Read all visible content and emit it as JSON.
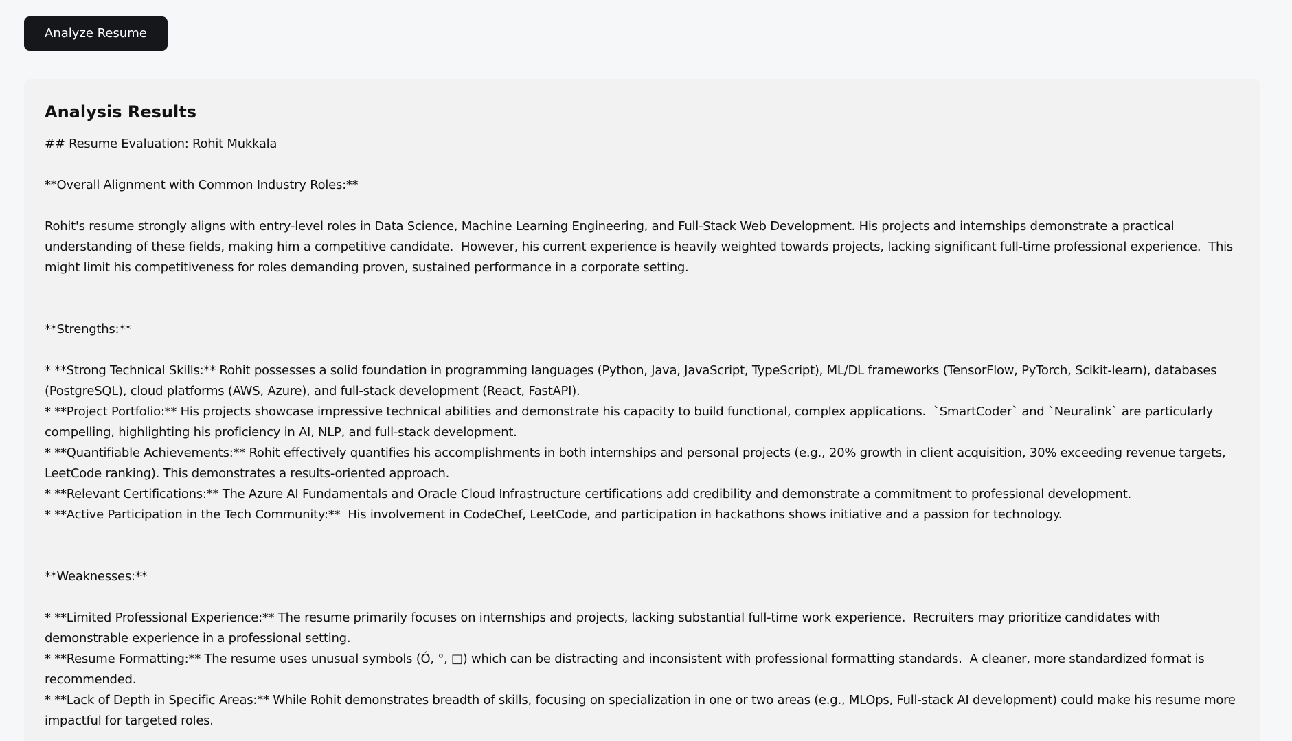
{
  "toolbar": {
    "analyze_label": "Analyze Resume"
  },
  "results": {
    "title": "Analysis Results",
    "body": "## Resume Evaluation: Rohit Mukkala\n\n**Overall Alignment with Common Industry Roles:**\n\nRohit's resume strongly aligns with entry-level roles in Data Science, Machine Learning Engineering, and Full-Stack Web Development. His projects and internships demonstrate a practical understanding of these fields, making him a competitive candidate.  However, his current experience is heavily weighted towards projects, lacking significant full-time professional experience.  This might limit his competitiveness for roles demanding proven, sustained performance in a corporate setting.\n\n\n**Strengths:**\n\n* **Strong Technical Skills:** Rohit possesses a solid foundation in programming languages (Python, Java, JavaScript, TypeScript), ML/DL frameworks (TensorFlow, PyTorch, Scikit-learn), databases (PostgreSQL), cloud platforms (AWS, Azure), and full-stack development (React, FastAPI).\n* **Project Portfolio:** His projects showcase impressive technical abilities and demonstrate his capacity to build functional, complex applications.  `SmartCoder` and `Neuralink` are particularly compelling, highlighting his proficiency in AI, NLP, and full-stack development.\n* **Quantifiable Achievements:** Rohit effectively quantifies his accomplishments in both internships and personal projects (e.g., 20% growth in client acquisition, 30% exceeding revenue targets, LeetCode ranking). This demonstrates a results-oriented approach.\n* **Relevant Certifications:** The Azure AI Fundamentals and Oracle Cloud Infrastructure certifications add credibility and demonstrate a commitment to professional development.\n* **Active Participation in the Tech Community:**  His involvement in CodeChef, LeetCode, and participation in hackathons shows initiative and a passion for technology.\n\n\n**Weaknesses:**\n\n* **Limited Professional Experience:** The resume primarily focuses on internships and projects, lacking substantial full-time work experience.  Recruiters may prioritize candidates with demonstrable experience in a professional setting.\n* **Resume Formatting:** The resume uses unusual symbols (Ó, °, □) which can be distracting and inconsistent with professional formatting standards.  A cleaner, more standardized format is recommended.\n* **Lack of Depth in Specific Areas:** While Rohit demonstrates breadth of skills, focusing on specialization in one or two areas (e.g., MLOps, Full-stack AI development) could make his resume more impactful for targeted roles."
  }
}
